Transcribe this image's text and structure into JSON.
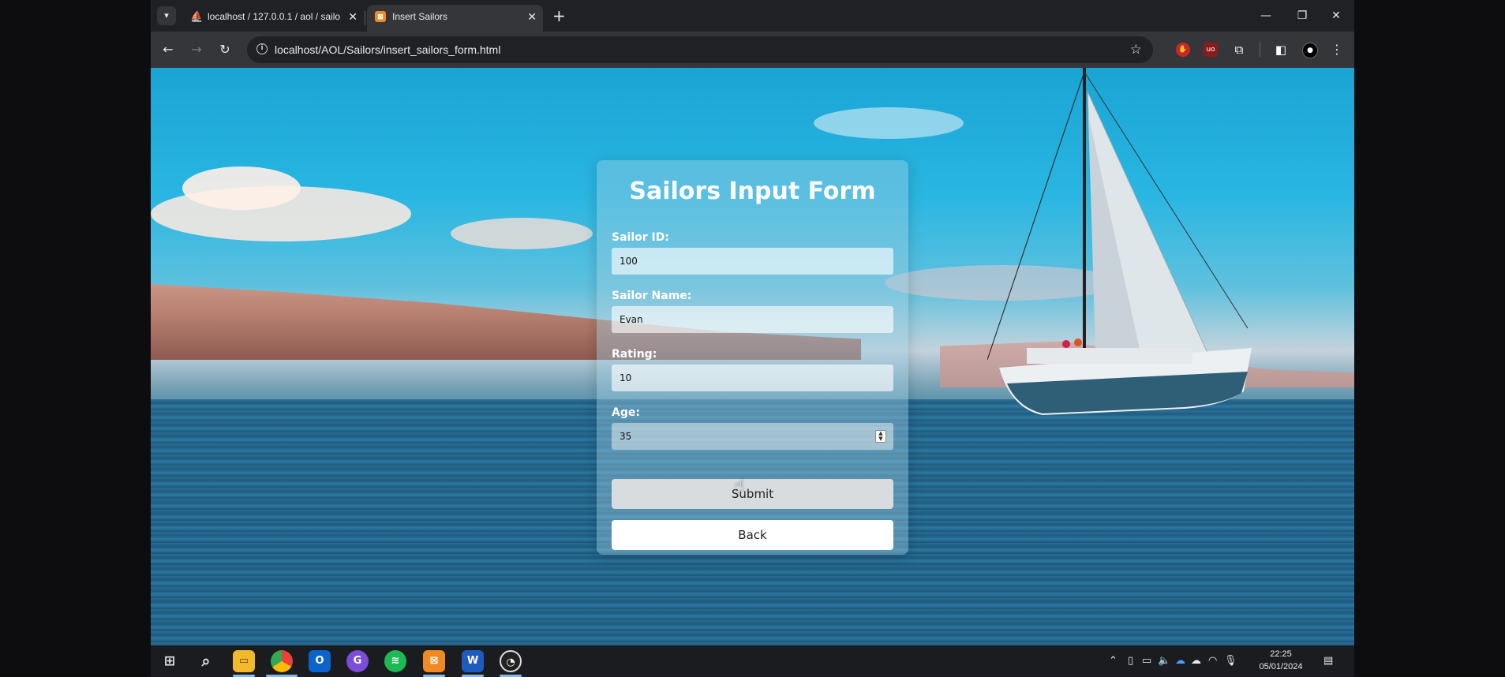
{
  "browser": {
    "tabs": [
      {
        "title": "localhost / 127.0.0.1 / aol / sailo"
      },
      {
        "title": "Insert Sailors",
        "active": true
      }
    ],
    "url": "localhost/AOL/Sailors/insert_sailors_form.html",
    "extensions": [
      "ublock-icon",
      "ublock-origin-icon",
      "extensions-icon",
      "sidepanel-icon",
      "profile-icon"
    ]
  },
  "form": {
    "title": "Sailors Input Form",
    "fields": [
      {
        "label": "Sailor ID:",
        "value": "100"
      },
      {
        "label": "Sailor Name:",
        "value": "Evan"
      },
      {
        "label": "Rating:",
        "value": "10"
      },
      {
        "label": "Age:",
        "value": "35"
      }
    ],
    "submit_label": "Submit",
    "back_label": "Back"
  },
  "taskbar": {
    "apps": [
      "file-explorer-icon",
      "chrome-icon",
      "outlook-icon",
      "messenger-icon",
      "spotify-icon",
      "xampp-icon",
      "word-icon",
      "obs-icon"
    ],
    "time": "22:25",
    "date": "05/01/2024"
  },
  "colors": {
    "sky": "#29b6e2",
    "sea": "#1f5b80",
    "card": "#a0cde1"
  }
}
